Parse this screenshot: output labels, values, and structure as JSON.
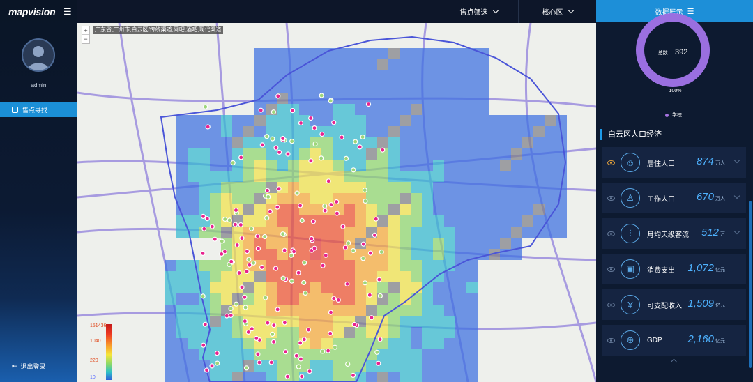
{
  "app": {
    "logo_text": "mapvision",
    "menu_icon": "hamburger-icon"
  },
  "user": {
    "name": "admin"
  },
  "sidebar": {
    "active_item": "售点寻找",
    "logout_label": "退出登录"
  },
  "topbar": {
    "filter_label": "售点筛选",
    "area_label": "核心区"
  },
  "map": {
    "breadcrumb": "广东省,广州市,白云区/传统渠道,网吧,酒吧,现代渠道",
    "zoom_in": "+",
    "zoom_out": "−",
    "colorbar_labels": [
      "151436",
      "1040",
      "220",
      "10"
    ]
  },
  "panel": {
    "header": "数据展示",
    "donut": {
      "key": "总数",
      "value": "392",
      "percent": "100%",
      "legend": "学校",
      "color": "#9a6fe0"
    },
    "section_title": "白云区人口经济",
    "stats": [
      {
        "label": "居住人口",
        "value": "874",
        "unit": "万人",
        "icon": "population-icon",
        "active": true,
        "dropdown": true
      },
      {
        "label": "工作人口",
        "value": "670",
        "unit": "万人",
        "icon": "worker-icon",
        "active": false,
        "dropdown": true
      },
      {
        "label": "月均天级客流",
        "value": "512",
        "unit": "万",
        "icon": "traffic-chart-icon",
        "active": false,
        "dropdown": true
      },
      {
        "label": "消费支出",
        "value": "1,072",
        "unit": "亿元",
        "icon": "wallet-icon",
        "active": false,
        "dropdown": false
      },
      {
        "label": "可支配收入",
        "value": "1,509",
        "unit": "亿元",
        "icon": "coin-icon",
        "active": false,
        "dropdown": false
      },
      {
        "label": "GDP",
        "value": "2,160",
        "unit": "亿元",
        "icon": "gdp-icon",
        "active": false,
        "dropdown": false
      }
    ]
  }
}
